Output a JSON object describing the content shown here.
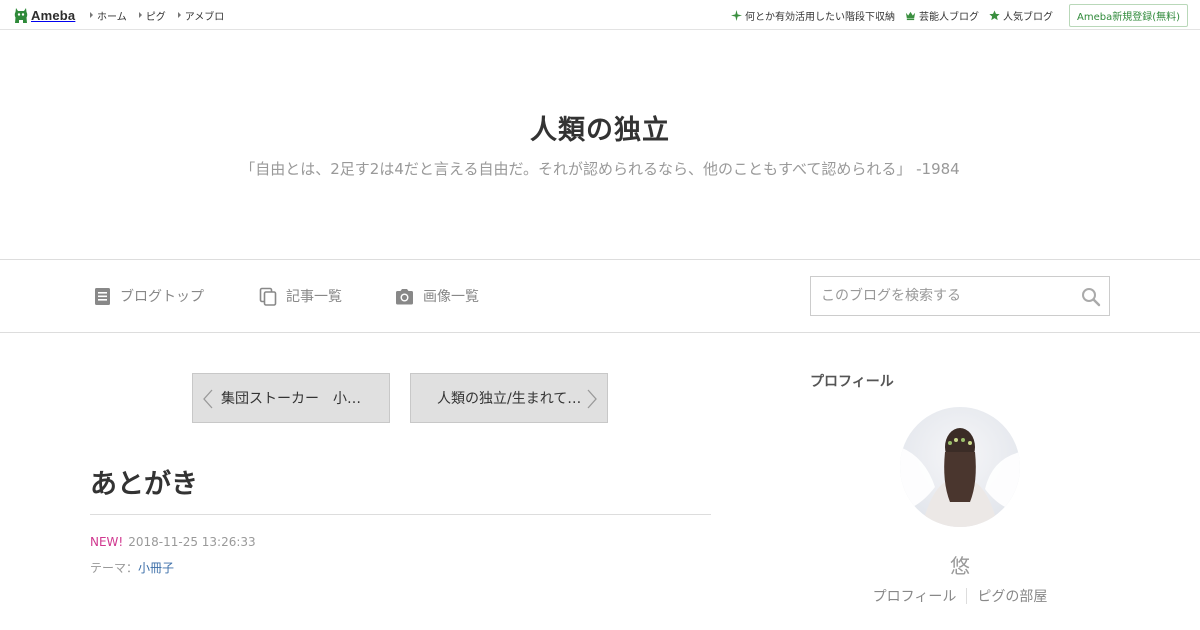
{
  "topbar": {
    "logo_text": "Ameba",
    "nav": [
      {
        "label": "ホーム"
      },
      {
        "label": "ピグ"
      },
      {
        "label": "アメブロ"
      }
    ],
    "right_links": [
      {
        "label": "何とか有効活用したい階段下収納",
        "icon": "sparkle-icon"
      },
      {
        "label": "芸能人ブログ",
        "icon": "crown-icon"
      },
      {
        "label": "人気ブログ",
        "icon": "star-icon"
      }
    ],
    "signup_label": "Ameba新規登録(無料)",
    "accent_color": "#2f8a3a"
  },
  "header": {
    "title": "人類の独立",
    "description": "「自由とは、2足す2は4だと言える自由だ。それが認められるなら、他のこともすべて認められる」 -1984"
  },
  "nav": {
    "items": [
      {
        "label": "ブログトップ",
        "icon": "document-icon"
      },
      {
        "label": "記事一覧",
        "icon": "copy-icon"
      },
      {
        "label": "画像一覧",
        "icon": "camera-icon"
      }
    ],
    "search_placeholder": "このブログを検索する"
  },
  "article": {
    "prev_label": "集団ストーカー　小…",
    "next_label": "人類の独立/生まれて…",
    "title": "あとがき",
    "new_badge": "NEW!",
    "date": "2018-11-25 13:26:33",
    "theme_label": "テーマ：",
    "theme_value": "小冊子"
  },
  "sidebar": {
    "heading": "プロフィール",
    "nickname": "悠",
    "links": [
      {
        "label": "プロフィール"
      },
      {
        "label": "ピグの部屋"
      }
    ]
  }
}
